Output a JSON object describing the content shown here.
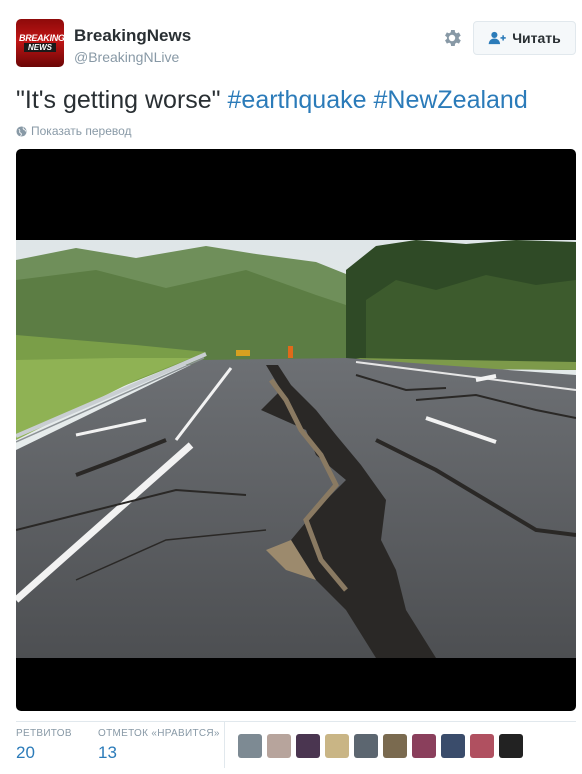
{
  "account": {
    "name": "BreakingNews",
    "handle": "@BreakingNLive",
    "avatar_logo_top": "BREAKING",
    "avatar_logo_bottom": "NEWS"
  },
  "follow_button": {
    "label": "Читать"
  },
  "tweet": {
    "text_quote": "\"It's getting worse\"",
    "hashtags": [
      "#earthquake",
      "#NewZealand"
    ]
  },
  "translate_link": "Показать перевод",
  "stats": {
    "retweets_label": "РЕТВИТОВ",
    "retweets_count": "20",
    "likes_label": "ОТМЕТОК «НРАВИТСЯ»",
    "likes_count": "13"
  },
  "colors": {
    "link_blue": "#2b7bb9",
    "muted_gray": "#8899a6",
    "text_dark": "#292f33",
    "border": "#e1e8ed"
  },
  "facepile_count": 10
}
